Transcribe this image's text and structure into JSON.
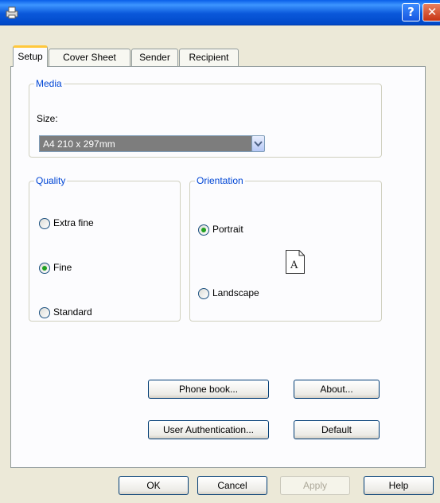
{
  "window": {
    "help_glyph": "?",
    "close_glyph": "✕"
  },
  "tabs": [
    {
      "label": "Setup",
      "active": true
    },
    {
      "label": "Cover Sheet",
      "active": false
    },
    {
      "label": "Sender",
      "active": false
    },
    {
      "label": "Recipient",
      "active": false
    }
  ],
  "media": {
    "legend": "Media",
    "size_label": "Size:",
    "size_value": "A4 210 x 297mm"
  },
  "quality": {
    "legend": "Quality",
    "options": [
      {
        "label": "Extra fine",
        "selected": false
      },
      {
        "label": "Fine",
        "selected": true
      },
      {
        "label": "Standard",
        "selected": false
      }
    ]
  },
  "orientation": {
    "legend": "Orientation",
    "options": [
      {
        "label": "Portrait",
        "selected": true
      },
      {
        "label": "Landscape",
        "selected": false
      }
    ],
    "preview_letter": "A"
  },
  "panel_buttons": {
    "phone_book": "Phone book...",
    "about": "About...",
    "user_auth": "User Authentication...",
    "default": "Default"
  },
  "footer_buttons": {
    "ok": "OK",
    "cancel": "Cancel",
    "apply": "Apply",
    "apply_disabled": true,
    "help": "Help"
  },
  "colors": {
    "title_bar": "#0a58da",
    "legend_text": "#0046d5",
    "active_tab_accent": "#ffc83c",
    "radio_dot": "#21a121"
  }
}
